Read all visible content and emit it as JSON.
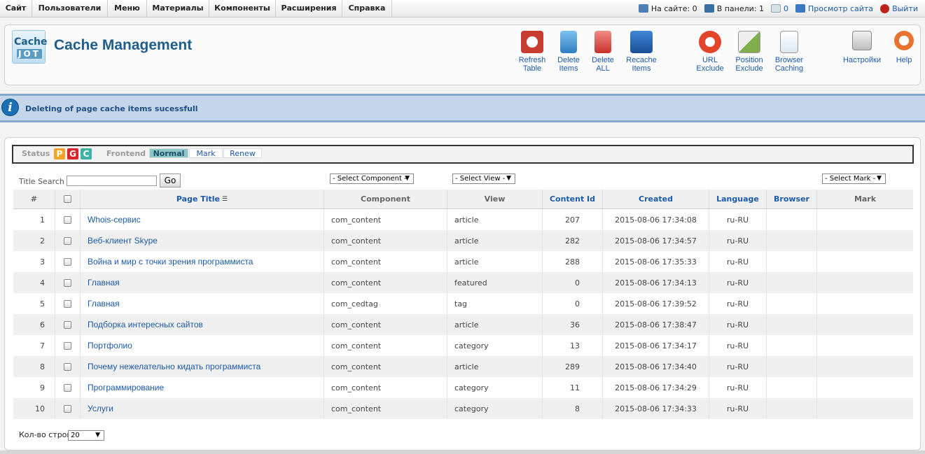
{
  "topmenu": {
    "items": [
      "Сайт",
      "Пользователи",
      "Меню",
      "Материалы",
      "Компоненты",
      "Расширения",
      "Справка"
    ],
    "on_site_label": "На сайте: 0",
    "in_panel_label": "В панели: 1",
    "messages_count": "0",
    "view_site": "Просмотр сайта",
    "logout": "Выйти"
  },
  "header": {
    "logo_line1": "Cache",
    "logo_line2": "JOT",
    "title": "Cache Management"
  },
  "toolbar": {
    "buttons": [
      {
        "line1": "Refresh",
        "line2": "Table",
        "icon": "refresh-icon",
        "color": "#c93b2e"
      },
      {
        "line1": "Delete",
        "line2": "Items",
        "icon": "trash-icon",
        "color": "#3a8fd0"
      },
      {
        "line1": "Delete",
        "line2": "ALL",
        "icon": "trash-all-icon",
        "color": "#d9534f"
      },
      {
        "line1": "Recache",
        "line2": "Items",
        "icon": "recache-icon",
        "color": "#2f6fbf"
      },
      {
        "line1": "URL",
        "line2": "Exclude",
        "icon": "url-exclude-icon",
        "color": "#e2452c"
      },
      {
        "line1": "Position",
        "line2": "Exclude",
        "icon": "position-exclude-icon",
        "color": "#7fae4a"
      },
      {
        "line1": "Browser",
        "line2": "Caching",
        "icon": "browser-caching-icon",
        "color": "#4a9ed6"
      },
      {
        "line1": "Настройки",
        "line2": "",
        "icon": "settings-icon",
        "color": "#8a8a8a"
      },
      {
        "line1": "Help",
        "line2": "",
        "icon": "help-icon",
        "color": "#e8732f"
      }
    ]
  },
  "message": {
    "text": "Deleting of page cache items sucessfull"
  },
  "filters": {
    "status_label": "Status",
    "status_codes": [
      "P",
      "G",
      "C"
    ],
    "status_colors": [
      "#f0a52a",
      "#d9262c",
      "#3cb3a3"
    ],
    "frontend_label": "Frontend",
    "modes": [
      "Normal",
      "Mark",
      "Renew"
    ],
    "active_mode": "Normal"
  },
  "search": {
    "label": "Title Search :",
    "value": "",
    "go": "Go",
    "component_select": "- Select Component -",
    "view_select": "- Select View -",
    "mark_select": "- Select Mark -"
  },
  "table": {
    "headers": [
      "#",
      "",
      "Page Title",
      "Component",
      "View",
      "Content Id",
      "Created",
      "Language",
      "Browser",
      "Mark"
    ],
    "rows": [
      {
        "n": "1",
        "title": "Whois-сервис",
        "component": "com_content",
        "view": "article",
        "id": "207",
        "created": "2015-08-06 17:34:08",
        "lang": "ru-RU"
      },
      {
        "n": "2",
        "title": "Веб-клиент Skype",
        "component": "com_content",
        "view": "article",
        "id": "282",
        "created": "2015-08-06 17:34:57",
        "lang": "ru-RU"
      },
      {
        "n": "3",
        "title": "Война и мир с точки зрения программиста",
        "component": "com_content",
        "view": "article",
        "id": "288",
        "created": "2015-08-06 17:35:33",
        "lang": "ru-RU"
      },
      {
        "n": "4",
        "title": "Главная",
        "component": "com_content",
        "view": "featured",
        "id": "0",
        "created": "2015-08-06 17:34:13",
        "lang": "ru-RU"
      },
      {
        "n": "5",
        "title": "Главная",
        "component": "com_cedtag",
        "view": "tag",
        "id": "0",
        "created": "2015-08-06 17:39:52",
        "lang": "ru-RU"
      },
      {
        "n": "6",
        "title": "Подборка интересных сайтов",
        "component": "com_content",
        "view": "article",
        "id": "36",
        "created": "2015-08-06 17:38:47",
        "lang": "ru-RU"
      },
      {
        "n": "7",
        "title": "Портфолио",
        "component": "com_content",
        "view": "category",
        "id": "13",
        "created": "2015-08-06 17:34:17",
        "lang": "ru-RU"
      },
      {
        "n": "8",
        "title": "Почему нежелательно кидать программиста",
        "component": "com_content",
        "view": "article",
        "id": "289",
        "created": "2015-08-06 17:34:40",
        "lang": "ru-RU"
      },
      {
        "n": "9",
        "title": "Программирование",
        "component": "com_content",
        "view": "category",
        "id": "11",
        "created": "2015-08-06 17:34:29",
        "lang": "ru-RU"
      },
      {
        "n": "10",
        "title": "Услуги",
        "component": "com_content",
        "view": "category",
        "id": "8",
        "created": "2015-08-06 17:34:33",
        "lang": "ru-RU"
      }
    ]
  },
  "footer": {
    "rows_label": "Кол-во строк:",
    "rows_value": "20"
  }
}
